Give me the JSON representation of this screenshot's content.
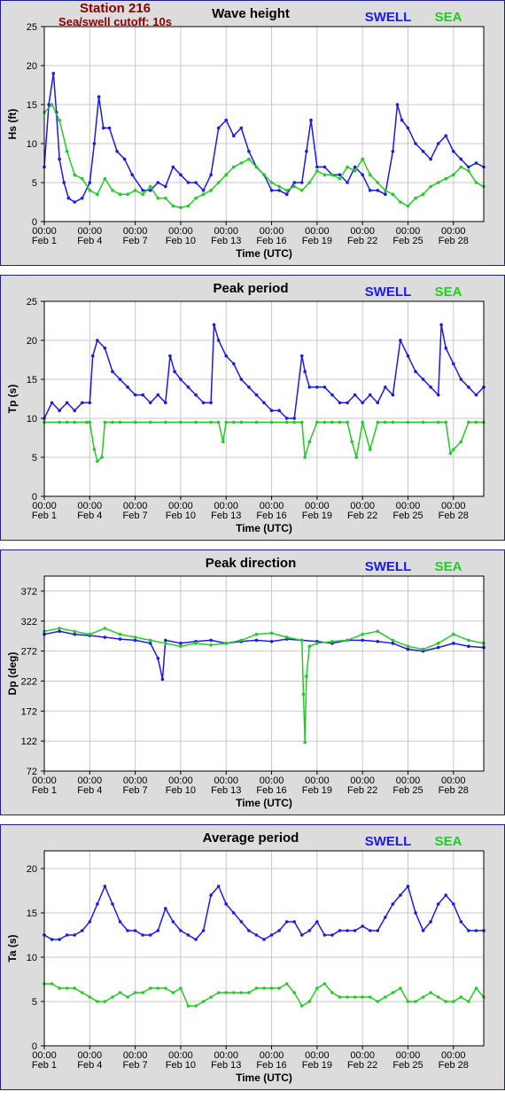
{
  "station": {
    "title": "Station 216",
    "cutoff": "Sea/swell cutoff: 10s",
    "title_color": "#8b0000"
  },
  "legend": {
    "swell_label": "SWELL",
    "sea_label": "SEA",
    "swell_color": "#1a1aee",
    "sea_color": "#22cc22"
  },
  "x_axis": {
    "label": "Time (UTC)",
    "ticks": [
      {
        "time": "00:00",
        "date": "Feb 1",
        "day": 1
      },
      {
        "time": "00:00",
        "date": "Feb 4",
        "day": 4
      },
      {
        "time": "00:00",
        "date": "Feb 7",
        "day": 7
      },
      {
        "time": "00:00",
        "date": "Feb 10",
        "day": 10
      },
      {
        "time": "00:00",
        "date": "Feb 13",
        "day": 13
      },
      {
        "time": "00:00",
        "date": "Feb 16",
        "day": 16
      },
      {
        "time": "00:00",
        "date": "Feb 19",
        "day": 19
      },
      {
        "time": "00:00",
        "date": "Feb 22",
        "day": 22
      },
      {
        "time": "00:00",
        "date": "Feb 25",
        "day": 25
      },
      {
        "time": "00:00",
        "date": "Feb 28",
        "day": 28
      }
    ],
    "range_days": [
      1,
      30
    ]
  },
  "chart_data": [
    {
      "type": "line",
      "title": "Wave height",
      "ylabel": "Hs (ft)",
      "ylim": [
        0,
        25
      ],
      "yticks": [
        0,
        5,
        10,
        15,
        20,
        25
      ],
      "grid": true,
      "legend": "top-right",
      "series": [
        {
          "name": "SWELL",
          "x": [
            1,
            1.3,
            1.6,
            1.8,
            2,
            2.3,
            2.6,
            3,
            3.5,
            4,
            4.3,
            4.6,
            4.9,
            5.3,
            5.8,
            6.3,
            6.8,
            7.5,
            8,
            8.5,
            9,
            9.5,
            10,
            10.5,
            11,
            11.5,
            12,
            12.5,
            13,
            13.5,
            14,
            14.5,
            15,
            15.5,
            16,
            16.5,
            17,
            17.5,
            18,
            18.3,
            18.6,
            19,
            19.5,
            20,
            20.5,
            21,
            21.5,
            22,
            22.5,
            23,
            23.5,
            24,
            24.3,
            24.6,
            25,
            25.5,
            26,
            26.5,
            27,
            27.5,
            28,
            28.5,
            29,
            29.5,
            30
          ],
          "values": [
            7,
            15,
            19,
            14,
            8,
            5,
            3,
            2.5,
            3,
            5,
            10,
            16,
            12,
            12,
            9,
            8,
            6,
            4,
            4,
            5,
            4.5,
            7,
            6,
            5,
            5,
            4,
            6,
            12,
            13,
            11,
            12,
            9,
            7,
            6,
            4,
            4,
            3.5,
            5,
            5,
            9,
            13,
            7,
            7,
            6,
            6,
            5,
            7,
            6,
            4,
            4,
            3.5,
            9,
            15,
            13,
            12,
            10,
            9,
            8,
            10,
            11,
            9,
            8,
            7,
            7.5,
            7
          ]
        },
        {
          "name": "SEA",
          "x": [
            1,
            1.5,
            2,
            2.5,
            3,
            3.5,
            4,
            4.5,
            5,
            5.5,
            6,
            6.5,
            7,
            7.5,
            8,
            8.5,
            9,
            9.5,
            10,
            10.5,
            11,
            11.5,
            12,
            12.5,
            13,
            13.5,
            14,
            14.5,
            15,
            15.5,
            16,
            16.5,
            17,
            17.5,
            18,
            18.5,
            19,
            19.5,
            20,
            20.5,
            21,
            21.5,
            22,
            22.5,
            23,
            23.5,
            24,
            24.5,
            25,
            25.5,
            26,
            26.5,
            27,
            27.5,
            28,
            28.5,
            29,
            29.5,
            30
          ],
          "values": [
            14,
            15,
            13,
            9,
            6,
            5.5,
            4,
            3.5,
            5.5,
            4,
            3.5,
            3.5,
            4,
            3.5,
            4.5,
            3,
            3,
            2,
            1.8,
            2,
            3,
            3.5,
            4,
            5,
            6,
            7,
            7.5,
            8,
            7,
            6,
            5,
            4.5,
            4,
            4.5,
            4,
            5,
            6.5,
            6,
            6,
            5.5,
            7,
            6.5,
            8,
            6,
            5,
            4,
            3.5,
            2.5,
            2,
            3,
            3.5,
            4.5,
            5,
            5.5,
            6,
            7,
            6.5,
            5,
            4.5
          ]
        }
      ]
    },
    {
      "type": "line",
      "title": "Peak period",
      "ylabel": "Tp (s)",
      "ylim": [
        0,
        25
      ],
      "yticks": [
        0,
        5,
        10,
        15,
        20,
        25
      ],
      "grid": true,
      "legend": "top-right",
      "series": [
        {
          "name": "SWELL",
          "x": [
            1,
            1.5,
            2,
            2.5,
            3,
            3.5,
            4,
            4.2,
            4.5,
            5,
            5.5,
            6,
            6.5,
            7,
            7.5,
            8,
            8.5,
            9,
            9.3,
            9.6,
            10,
            10.5,
            11,
            11.5,
            12,
            12.2,
            12.5,
            13,
            13.5,
            14,
            14.5,
            15,
            15.5,
            16,
            16.5,
            17,
            17.5,
            18,
            18.2,
            18.5,
            19,
            19.5,
            20,
            20.5,
            21,
            21.5,
            22,
            22.5,
            23,
            23.5,
            24,
            24.5,
            25,
            25.5,
            26,
            26.5,
            27,
            27.2,
            27.5,
            28,
            28.5,
            29,
            29.5,
            30
          ],
          "values": [
            10,
            12,
            11,
            12,
            11,
            12,
            12,
            18,
            20,
            19,
            16,
            15,
            14,
            13,
            13,
            12,
            13,
            12,
            18,
            16,
            15,
            14,
            13,
            12,
            12,
            22,
            20,
            18,
            17,
            15,
            14,
            13,
            12,
            11,
            11,
            10,
            10,
            18,
            16,
            14,
            14,
            14,
            13,
            12,
            12,
            13,
            12,
            13,
            12,
            14,
            13,
            20,
            18,
            16,
            15,
            14,
            13,
            22,
            19,
            17,
            15,
            14,
            13,
            14
          ]
        },
        {
          "name": "SEA",
          "x": [
            1,
            2,
            2.5,
            3,
            3.8,
            4,
            4.3,
            4.5,
            4.8,
            5,
            5.5,
            6,
            7,
            8,
            9,
            10,
            11,
            12,
            12.5,
            12.8,
            13,
            13.5,
            14,
            15,
            16,
            17,
            17.5,
            18,
            18.2,
            18.5,
            19,
            19.5,
            20,
            20.5,
            21,
            21.3,
            21.6,
            22,
            22.5,
            23,
            23.5,
            24,
            25,
            26,
            27,
            27.5,
            27.8,
            28,
            28.5,
            29,
            29.5,
            30
          ],
          "values": [
            9.5,
            9.5,
            9.5,
            9.5,
            9.5,
            9.5,
            6,
            4.5,
            5,
            9.5,
            9.5,
            9.5,
            9.5,
            9.5,
            9.5,
            9.5,
            9.5,
            9.5,
            9.5,
            7,
            9.5,
            9.5,
            9.5,
            9.5,
            9.5,
            9.5,
            9.5,
            9.5,
            5,
            7,
            9.5,
            9.5,
            9.5,
            9.5,
            9.5,
            7,
            5,
            9.5,
            6,
            9.5,
            9.5,
            9.5,
            9.5,
            9.5,
            9.5,
            9.5,
            5.5,
            6,
            7,
            9.5,
            9.5,
            9.5
          ]
        }
      ]
    },
    {
      "type": "line",
      "title": "Peak direction",
      "ylabel": "Dp (deg)",
      "ylim": [
        72,
        397
      ],
      "yticks": [
        72,
        122,
        172,
        222,
        272,
        322,
        372
      ],
      "grid": true,
      "legend": "top-right",
      "series": [
        {
          "name": "SWELL",
          "x": [
            1,
            2,
            3,
            4,
            5,
            6,
            7,
            8,
            8.5,
            8.8,
            9,
            10,
            11,
            12,
            13,
            14,
            15,
            16,
            17,
            18,
            19,
            20,
            21,
            22,
            23,
            24,
            25,
            26,
            27,
            28,
            29,
            30
          ],
          "values": [
            300,
            305,
            300,
            298,
            295,
            292,
            290,
            285,
            260,
            225,
            290,
            285,
            288,
            290,
            285,
            288,
            290,
            288,
            292,
            290,
            288,
            285,
            290,
            290,
            288,
            285,
            275,
            272,
            278,
            285,
            280,
            278
          ]
        },
        {
          "name": "SEA",
          "x": [
            1,
            2,
            3,
            4,
            5,
            6,
            7,
            8,
            9,
            10,
            11,
            12,
            13,
            14,
            15,
            16,
            17,
            18,
            18.1,
            18.2,
            18.3,
            18.5,
            19,
            20,
            21,
            22,
            23,
            24,
            25,
            26,
            27,
            28,
            29,
            30
          ],
          "values": [
            305,
            310,
            305,
            300,
            310,
            300,
            295,
            290,
            285,
            280,
            285,
            282,
            285,
            290,
            300,
            302,
            295,
            290,
            200,
            120,
            230,
            280,
            285,
            288,
            290,
            300,
            305,
            290,
            280,
            275,
            285,
            300,
            290,
            285
          ]
        }
      ]
    },
    {
      "type": "line",
      "title": "Average period",
      "ylabel": "Ta (s)",
      "ylim": [
        0,
        22
      ],
      "yticks": [
        0,
        5,
        10,
        15,
        20
      ],
      "grid": true,
      "legend": "top-right",
      "series": [
        {
          "name": "SWELL",
          "x": [
            1,
            1.5,
            2,
            2.5,
            3,
            3.5,
            4,
            4.5,
            5,
            5.5,
            6,
            6.5,
            7,
            7.5,
            8,
            8.5,
            9,
            9.5,
            10,
            10.5,
            11,
            11.5,
            12,
            12.5,
            13,
            13.5,
            14,
            14.5,
            15,
            15.5,
            16,
            16.5,
            17,
            17.5,
            18,
            18.5,
            19,
            19.5,
            20,
            20.5,
            21,
            21.5,
            22,
            22.5,
            23,
            23.5,
            24,
            24.5,
            25,
            25.5,
            26,
            26.5,
            27,
            27.5,
            28,
            28.5,
            29,
            29.5,
            30
          ],
          "values": [
            12.5,
            12,
            12,
            12.5,
            12.5,
            13,
            14,
            16,
            18,
            16,
            14,
            13,
            13,
            12.5,
            12.5,
            13,
            15.5,
            14,
            13,
            12.5,
            12,
            13,
            17,
            18,
            16,
            15,
            14,
            13,
            12.5,
            12,
            12.5,
            13,
            14,
            14,
            12.5,
            13,
            14,
            12.5,
            12.5,
            13,
            13,
            13,
            13.5,
            13,
            13,
            14.5,
            16,
            17,
            18,
            15,
            13,
            14,
            16,
            17,
            16,
            14,
            13,
            13,
            13
          ]
        },
        {
          "name": "SEA",
          "x": [
            1,
            1.5,
            2,
            2.5,
            3,
            3.5,
            4,
            4.5,
            5,
            5.5,
            6,
            6.5,
            7,
            7.5,
            8,
            8.5,
            9,
            9.5,
            10,
            10.5,
            11,
            11.5,
            12,
            12.5,
            13,
            13.5,
            14,
            14.5,
            15,
            15.5,
            16,
            16.5,
            17,
            17.5,
            18,
            18.5,
            19,
            19.5,
            20,
            20.5,
            21,
            21.5,
            22,
            22.5,
            23,
            23.5,
            24,
            24.5,
            25,
            25.5,
            26,
            26.5,
            27,
            27.5,
            28,
            28.5,
            29,
            29.5,
            30
          ],
          "values": [
            7,
            7,
            6.5,
            6.5,
            6.5,
            6,
            5.5,
            5,
            5,
            5.5,
            6,
            5.5,
            6,
            6,
            6.5,
            6.5,
            6.5,
            6,
            6.5,
            4.5,
            4.5,
            5,
            5.5,
            6,
            6,
            6,
            6,
            6,
            6.5,
            6.5,
            6.5,
            6.5,
            7,
            6,
            4.5,
            5,
            6.5,
            7,
            6,
            5.5,
            5.5,
            5.5,
            5.5,
            5.5,
            5,
            5.5,
            6,
            6.5,
            5,
            5,
            5.5,
            6,
            5.5,
            5,
            5,
            5.5,
            5,
            6.5,
            5.5
          ]
        }
      ]
    }
  ]
}
